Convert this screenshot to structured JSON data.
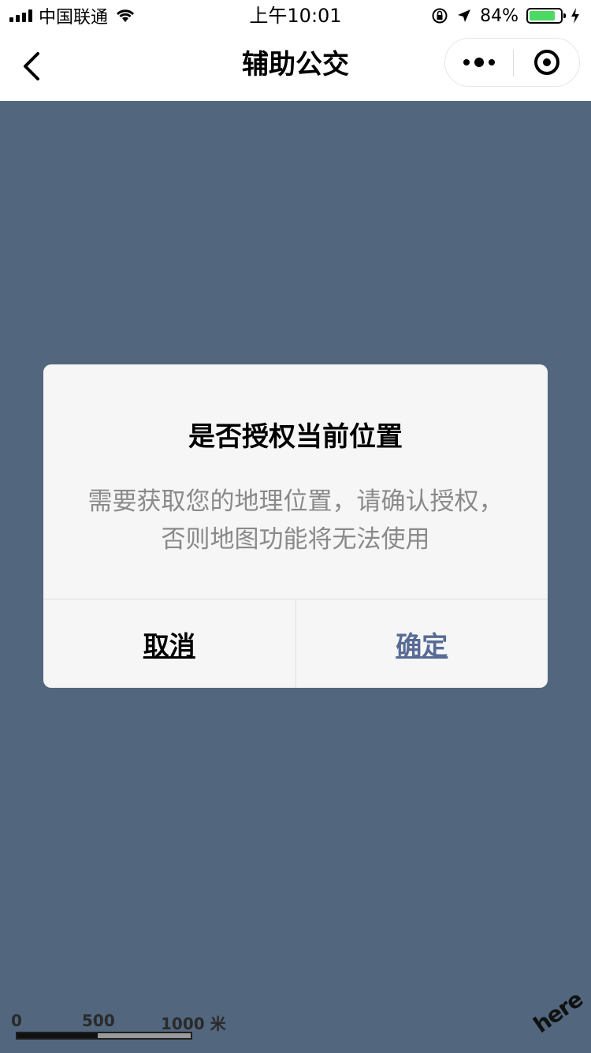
{
  "status_bar": {
    "carrier": "中国联通",
    "time": "上午10:01",
    "battery_percent": "84%",
    "battery_level": 0.84,
    "icons": [
      "signal-icon",
      "wifi-icon",
      "orientation-lock-icon",
      "location-icon",
      "battery-icon",
      "charging-icon"
    ]
  },
  "nav": {
    "title": "辅助公交",
    "icons": [
      "back-icon",
      "more-icon",
      "close-target-icon"
    ]
  },
  "dialog": {
    "title": "是否授权当前位置",
    "content": "需要获取您的地理位置，请确认授权，否则地图功能将无法使用",
    "cancel_label": "取消",
    "confirm_label": "确定"
  },
  "map": {
    "scale_labels": [
      "0",
      "500",
      "1000 米"
    ],
    "logo_text": "here"
  },
  "colors": {
    "map_background": "#52677e",
    "dialog_background": "#f6f6f6",
    "confirm_text": "#576b95",
    "battery_fill": "#4cd964"
  }
}
